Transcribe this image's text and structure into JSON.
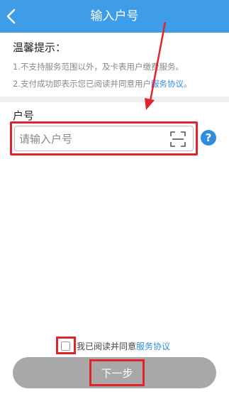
{
  "header": {
    "title": "输入户号",
    "back_icon": "back-chevron-icon",
    "background_color": "#3f9de8"
  },
  "tips": {
    "title": "温馨提示：",
    "line1": "1.不支持服务范围以外，及卡表用户缴费服务。",
    "line2_text": "2.支付成功即表示您已阅读并同意用户",
    "line2_link": "服务协议",
    "line2_end": "。"
  },
  "account": {
    "label": "户号",
    "placeholder": "请输入户号",
    "value": "",
    "scan_icon": "scan-icon",
    "help_icon": "help-icon",
    "help_glyph": "?"
  },
  "agreement": {
    "checked": false,
    "text": "我已阅读并同意",
    "link": "服务协议"
  },
  "next_button": {
    "label": "下一步"
  },
  "colors": {
    "accent": "#3f9de8",
    "link": "#2f8de0",
    "highlight": "#e0242c",
    "button_disabled": "#a8a8a8"
  }
}
